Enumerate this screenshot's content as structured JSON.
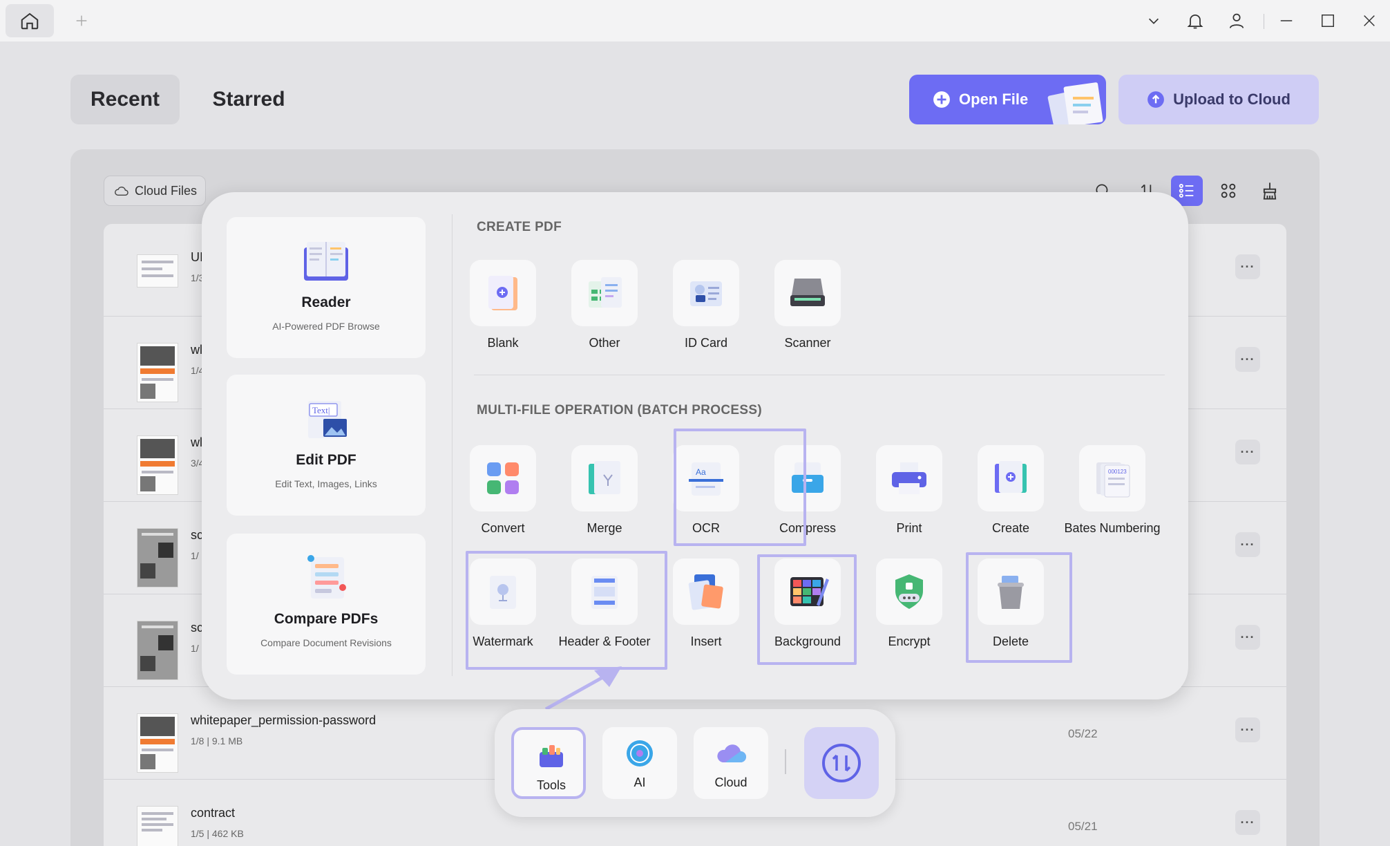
{
  "titlebar": {
    "icons": [
      "home-icon",
      "plus-icon",
      "chevron-down-icon",
      "bell-icon",
      "user-icon",
      "minimize-icon",
      "maximize-icon",
      "close-icon"
    ]
  },
  "main_tabs": [
    {
      "label": "Recent",
      "active": true
    },
    {
      "label": "Starred",
      "active": false
    }
  ],
  "actions": {
    "open_file": "Open File",
    "upload_cloud": "Upload to Cloud"
  },
  "toolbar": {
    "cloud_files": "Cloud Files",
    "accent_color": "#6d6cf3"
  },
  "files": [
    {
      "name": "UI",
      "meta": "1/3",
      "date": ""
    },
    {
      "name": "wl",
      "meta": "1/4",
      "date": ""
    },
    {
      "name": "wl",
      "meta": "3/4",
      "date": ""
    },
    {
      "name": "sc",
      "meta": "1/",
      "date": ""
    },
    {
      "name": "sc",
      "meta": "1/",
      "date": ""
    },
    {
      "name": "whitepaper_permission-password",
      "meta": "1/8 | 9.1 MB",
      "date": "05/22"
    },
    {
      "name": "contract",
      "meta": "1/5 | 462 KB",
      "date": "05/21"
    }
  ],
  "more_label": "···",
  "popup": {
    "features": [
      {
        "title": "Reader",
        "subtitle": "AI-Powered PDF Browse",
        "icon": "book-icon"
      },
      {
        "title": "Edit PDF",
        "subtitle": "Edit Text, Images, Links",
        "icon": "edit-text-icon",
        "badge": "Text|"
      },
      {
        "title": "Compare PDFs",
        "subtitle": "Compare Document Revisions",
        "icon": "compare-icon"
      }
    ],
    "create_title": "CREATE PDF",
    "create_tools": [
      {
        "label": "Blank",
        "icon": "blank-page-icon"
      },
      {
        "label": "Other",
        "icon": "other-files-icon"
      },
      {
        "label": "ID Card",
        "icon": "id-card-icon"
      },
      {
        "label": "Scanner",
        "icon": "scanner-icon"
      }
    ],
    "batch_title": "MULTI-FILE OPERATION (BATCH PROCESS)",
    "batch_row1": [
      {
        "label": "Convert",
        "icon": "convert-icon"
      },
      {
        "label": "Merge",
        "icon": "merge-icon"
      },
      {
        "label": "OCR",
        "icon": "ocr-icon"
      },
      {
        "label": "Compress",
        "icon": "compress-icon"
      },
      {
        "label": "Print",
        "icon": "print-icon"
      },
      {
        "label": "Create",
        "icon": "create-icon"
      },
      {
        "label": "Bates Numbering",
        "icon": "bates-numbering-icon",
        "badge": "000123"
      }
    ],
    "batch_row2": [
      {
        "label": "Watermark",
        "icon": "watermark-icon"
      },
      {
        "label": "Header & Footer",
        "icon": "header-footer-icon"
      },
      {
        "label": "Insert",
        "icon": "insert-icon"
      },
      {
        "label": "Background",
        "icon": "background-icon"
      },
      {
        "label": "Encrypt",
        "icon": "encrypt-icon"
      },
      {
        "label": "Delete",
        "icon": "delete-icon"
      }
    ],
    "ocr_badge": "Aa"
  },
  "dock": [
    {
      "label": "Tools",
      "icon": "toolbox-icon",
      "active": true
    },
    {
      "label": "AI",
      "icon": "ai-icon",
      "active": false
    },
    {
      "label": "Cloud",
      "icon": "cloud-icon",
      "active": false
    }
  ]
}
